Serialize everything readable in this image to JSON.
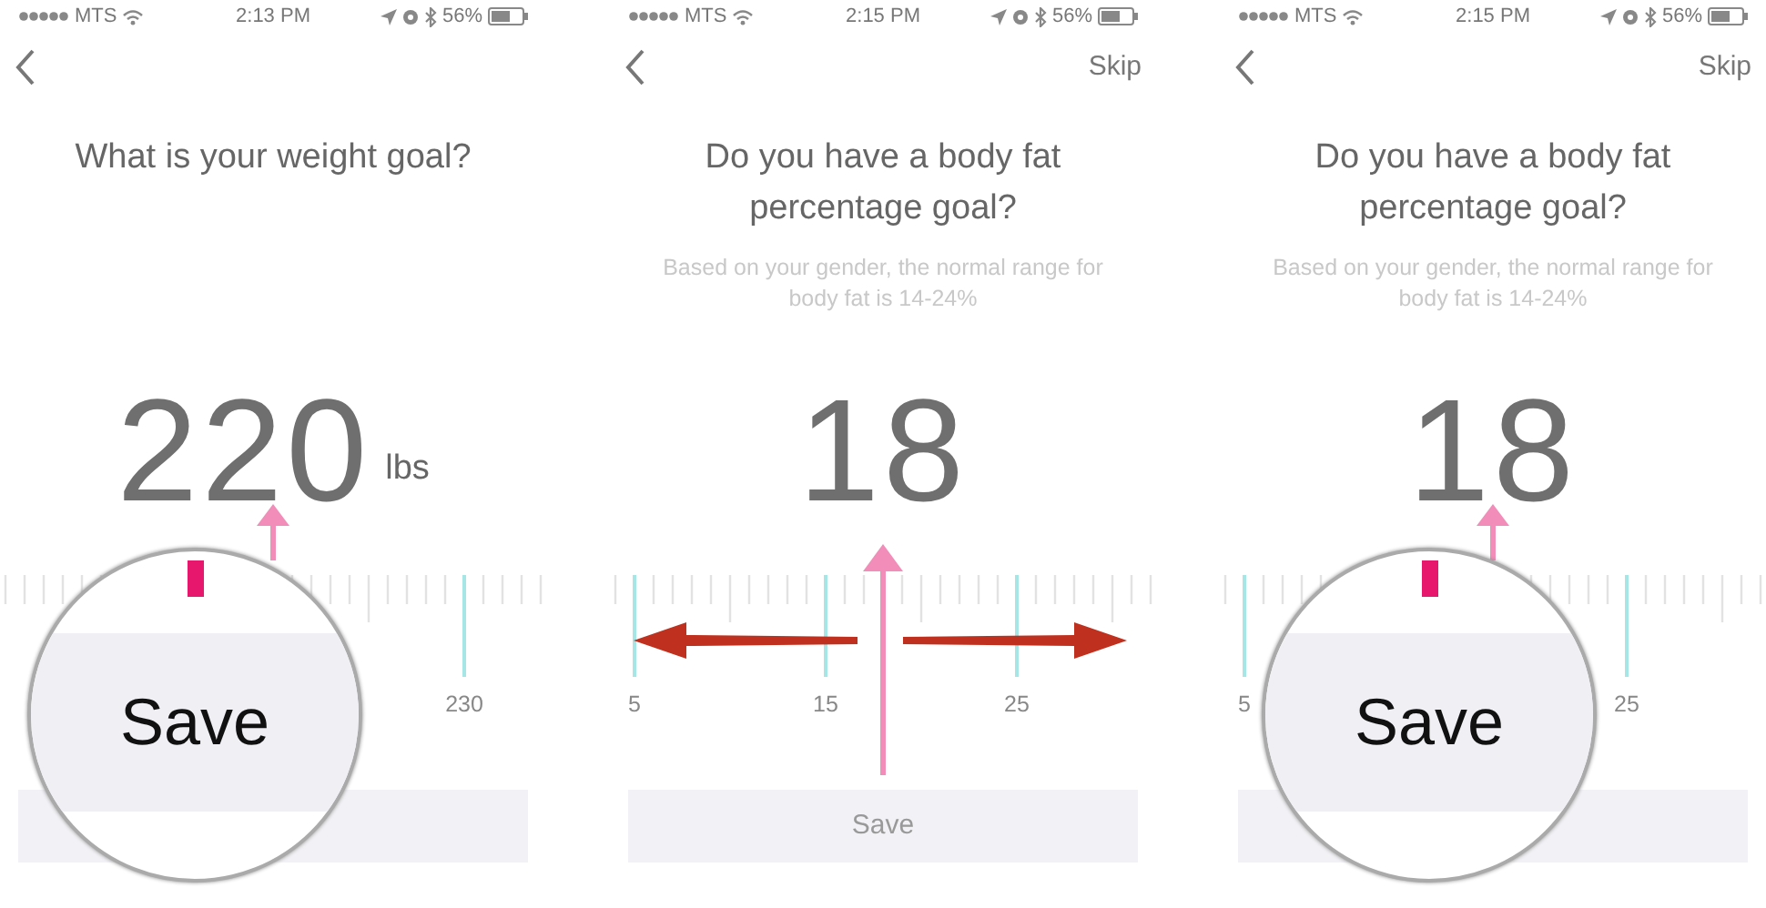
{
  "screens": [
    {
      "status_bar": {
        "carrier": "MTS",
        "time": "2:13 PM",
        "battery": "56%"
      },
      "question": "What is your weight goal?",
      "value": "220",
      "unit": "lbs",
      "ruler_labels": [
        "230"
      ],
      "magnifier": {
        "label": "Save"
      },
      "annotations": [
        {
          "kind": "pointer-short"
        }
      ]
    },
    {
      "status_bar": {
        "carrier": "MTS",
        "time": "2:15 PM",
        "battery": "56%"
      },
      "skip": "Skip",
      "question": "Do you have a body fat percentage goal?",
      "hint": "Based on your gender, the normal range for body fat is 14-24%",
      "value": "18",
      "ruler_labels": [
        "5",
        "15",
        "25"
      ],
      "save_label": "Save",
      "annotations": [
        {
          "kind": "pointer-long"
        },
        {
          "kind": "left"
        },
        {
          "kind": "right"
        }
      ]
    },
    {
      "status_bar": {
        "carrier": "MTS",
        "time": "2:15 PM",
        "battery": "56%"
      },
      "skip": "Skip",
      "question": "Do you have a body fat percentage goal?",
      "hint": "Based on your gender, the normal range for body fat is 14-24%",
      "value": "18",
      "ruler_labels": [
        "5",
        "25"
      ],
      "magnifier": {
        "label": "Save"
      },
      "annotations": [
        {
          "kind": "pointer-short"
        }
      ]
    }
  ]
}
